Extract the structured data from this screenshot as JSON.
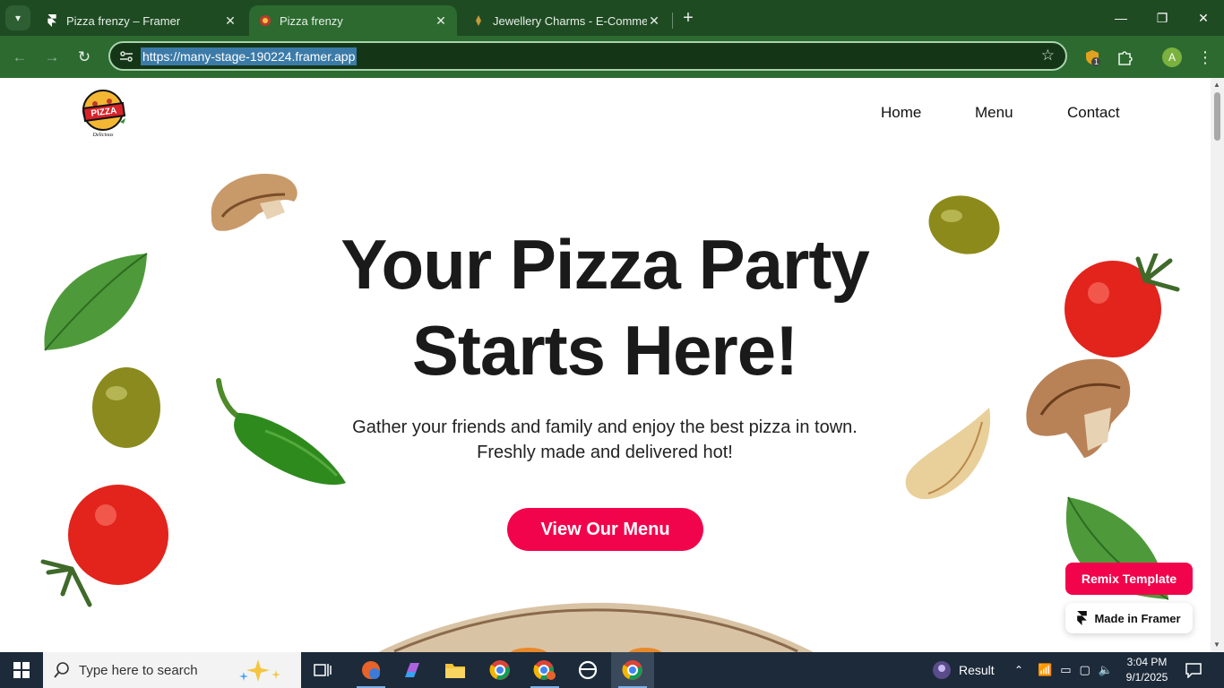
{
  "browser": {
    "tabs": [
      {
        "title": "Pizza frenzy – Framer",
        "active": false
      },
      {
        "title": "Pizza frenzy",
        "active": true
      },
      {
        "title": "Jewellery Charms - E-Commerce",
        "active": false
      }
    ],
    "url": "https://many-stage-190224.framer.app",
    "extension_badge": "1",
    "profile_initial": "A"
  },
  "site": {
    "logo_text": "PIZZA",
    "logo_subtext": "Delicious",
    "nav": [
      "Home",
      "Menu",
      "Contact"
    ],
    "hero": {
      "title_line1": "Your Pizza Party",
      "title_line2": "Starts Here!",
      "subtitle_line1": "Gather your friends and family and enjoy the best pizza in town.",
      "subtitle_line2": "Freshly made and delivered hot!",
      "cta": "View Our Menu"
    },
    "badges": {
      "remix": "Remix Template",
      "made_in": "Made in Framer"
    },
    "colors": {
      "accent": "#f2044c",
      "text": "#1a1a1a"
    }
  },
  "taskbar": {
    "search_placeholder": "Type here to search",
    "tray_label": "Result",
    "time": "3:04 PM",
    "date": "9/1/2025"
  }
}
